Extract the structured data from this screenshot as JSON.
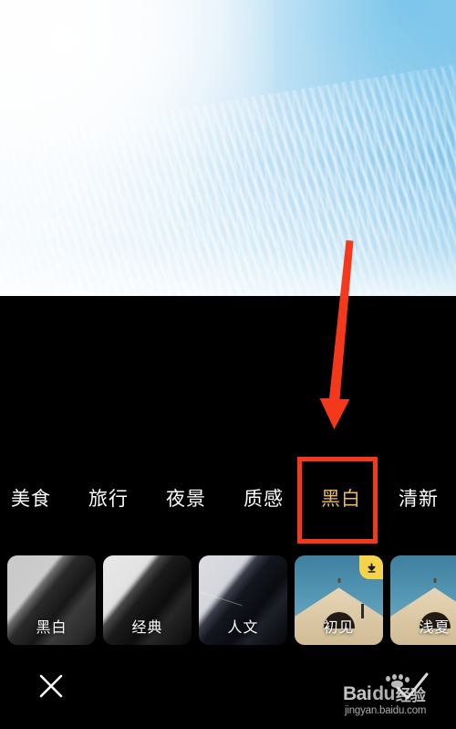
{
  "app": {
    "screen_name": "photo-filter-editor",
    "background_color": "#000000"
  },
  "photo_preview": {
    "subject": "blue sky with rippled mackerel clouds",
    "sky_color": "#6fbde7",
    "cloud_color": "#ffffff"
  },
  "category_tabs": {
    "items": [
      {
        "label": "美食",
        "active": false
      },
      {
        "label": "旅行",
        "active": false
      },
      {
        "label": "夜景",
        "active": false
      },
      {
        "label": "质感",
        "active": false
      },
      {
        "label": "黑白",
        "active": true
      },
      {
        "label": "清新",
        "active": false
      }
    ],
    "active_color": "#e8bc5a",
    "inactive_color": "#ffffff"
  },
  "filter_strip": {
    "items": [
      {
        "label": "黑白",
        "style": "mono-a",
        "has_download_badge": false
      },
      {
        "label": "经典",
        "style": "mono-b",
        "has_download_badge": false
      },
      {
        "label": "人文",
        "style": "mono-c",
        "has_download_badge": false
      },
      {
        "label": "初见",
        "style": "house",
        "has_download_badge": true
      },
      {
        "label": "浅夏",
        "style": "house",
        "has_download_badge": false
      }
    ],
    "badge_color": "#f5d34a",
    "badge_icon": "download-arrow-icon"
  },
  "bottom_bar": {
    "close_icon": "close-x-icon"
  },
  "watermark": {
    "brand_bai": "Bai",
    "brand_du": "du",
    "brand_suffix": "经验",
    "url": "jingyan.baidu.com"
  },
  "annotations": {
    "arrow": {
      "icon": "red-down-arrow-icon",
      "color": "#f4381b",
      "points_to": "黑白"
    },
    "highlight_box": {
      "color": "#f4381b",
      "targets": "黑白"
    }
  }
}
